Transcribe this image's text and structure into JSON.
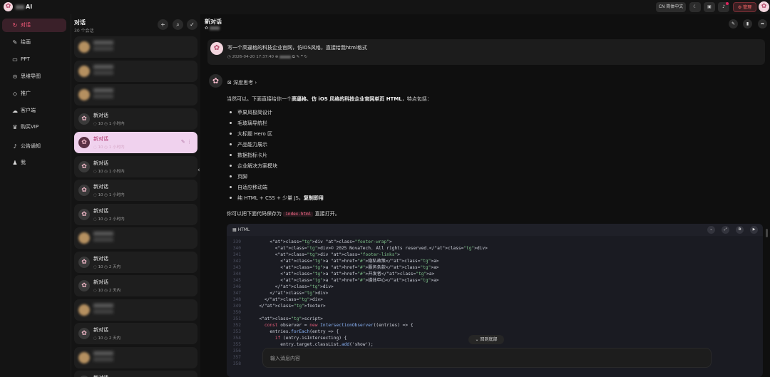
{
  "app": {
    "name": "AI",
    "logo_icon": "✿"
  },
  "topbar": {
    "language": "简体中文",
    "admin_label": "管理",
    "accent": "#ff5d7e"
  },
  "nav": {
    "items": [
      {
        "label": "对话",
        "icon": "chat-icon",
        "glyph": "↻"
      },
      {
        "label": "绘画",
        "icon": "brush-icon",
        "glyph": "✎"
      },
      {
        "label": "PPT",
        "icon": "ppt-icon",
        "glyph": "▭"
      },
      {
        "label": "思维导图",
        "icon": "mindmap-icon",
        "glyph": "⊙"
      },
      {
        "label": "推广",
        "icon": "diamond-icon",
        "glyph": "◇"
      },
      {
        "label": "客户端",
        "icon": "cloud-icon",
        "glyph": "☁"
      },
      {
        "label": "购买VIP",
        "icon": "crown-icon",
        "glyph": "♛"
      },
      {
        "label": "公告通知",
        "icon": "bell-icon",
        "glyph": "♪"
      },
      {
        "label": "我",
        "icon": "user-icon",
        "glyph": "♟"
      }
    ],
    "collapse_glyph": "☰"
  },
  "conversations": {
    "title": "对话",
    "count": "30 个会话",
    "items": [
      {
        "name": "",
        "messages": "",
        "time": "",
        "blurred": true
      },
      {
        "name": "",
        "messages": "",
        "time": "",
        "blurred": true
      },
      {
        "name": "",
        "messages": "",
        "time": "",
        "blurred": true
      },
      {
        "name": "新对话",
        "messages": "10",
        "time": "1 小时内"
      },
      {
        "name": "新对话",
        "messages": "10",
        "time": "1 小时内",
        "active": true
      },
      {
        "name": "新对话",
        "messages": "10",
        "time": "1 小时内"
      },
      {
        "name": "新对话",
        "messages": "10",
        "time": "1 小时内"
      },
      {
        "name": "新对话",
        "messages": "10",
        "time": "2 小时内"
      },
      {
        "name": "",
        "messages": "",
        "time": "",
        "blurred": true
      },
      {
        "name": "新对话",
        "messages": "10",
        "time": "2 天内"
      },
      {
        "name": "新对话",
        "messages": "10",
        "time": "2 天内"
      },
      {
        "name": "",
        "messages": "",
        "time": "",
        "blurred": true
      },
      {
        "name": "新对话",
        "messages": "10",
        "time": "2 天内"
      },
      {
        "name": "",
        "messages": "",
        "time": "",
        "blurred": true
      },
      {
        "name": "新对话",
        "messages": "",
        "time": ""
      }
    ]
  },
  "chat": {
    "title": "新对话",
    "user_message": "写一个高逼格的科技企业官网，仿iOS风格，直接给我html格式",
    "user_time": "2026-04-20 17:37:40",
    "think_label": "深度思考",
    "reply_intro_pre": "当然可以。下面直接给你一个",
    "reply_intro_bold": "高逼格、仿 iOS 风格的科技企业官网单页 HTML",
    "reply_intro_post": "，特点包括：",
    "features": [
      "苹果风极简设计",
      "毛玻璃导航栏",
      "大标题 Hero 区",
      "产品能力展示",
      "数据指标卡片",
      "企业解决方案模块",
      "页脚",
      "自适应移动端"
    ],
    "feature_last_pre": "纯 HTML + CSS + 少量 JS，",
    "feature_last_bold": "复制即用",
    "save_pre": "你可以把下面代码保存为",
    "save_file": "index.html",
    "save_post": "直接打开。",
    "code_lang": "HTML",
    "code": [
      {
        "n": "339",
        "t": "      <div class=\"footer-wrap\">"
      },
      {
        "n": "340",
        "t": "        <div>© 2025 NovaTech. All rights reserved.</div>"
      },
      {
        "n": "341",
        "t": "        <div class=\"footer-links\">"
      },
      {
        "n": "342",
        "t": "          <a href=\"#\">隐私政策</a>"
      },
      {
        "n": "343",
        "t": "          <a href=\"#\">服务条款</a>"
      },
      {
        "n": "344",
        "t": "          <a href=\"#\">开发者</a>"
      },
      {
        "n": "345",
        "t": "          <a href=\"#\">媒体中心</a>"
      },
      {
        "n": "346",
        "t": "        </div>"
      },
      {
        "n": "347",
        "t": "      </div>"
      },
      {
        "n": "348",
        "t": "    </div>"
      },
      {
        "n": "349",
        "t": "  </footer>"
      },
      {
        "n": "350",
        "t": ""
      },
      {
        "n": "351",
        "t": "  <script>"
      },
      {
        "n": "352",
        "t": "    const observer = new IntersectionObserver((entries) => {"
      },
      {
        "n": "353",
        "t": "      entries.forEach(entry => {"
      },
      {
        "n": "354",
        "t": "        if (entry.isIntersecting) {"
      },
      {
        "n": "355",
        "t": "          entry.target.classList.add('show');"
      },
      {
        "n": "356",
        "t": "        }"
      },
      {
        "n": "357",
        "t": "      });"
      },
      {
        "n": "358",
        "t": "    }, { threshold: 0.12 });"
      }
    ],
    "back_to_bottom": "回到底部",
    "input_placeholder": "输入消息内容"
  }
}
